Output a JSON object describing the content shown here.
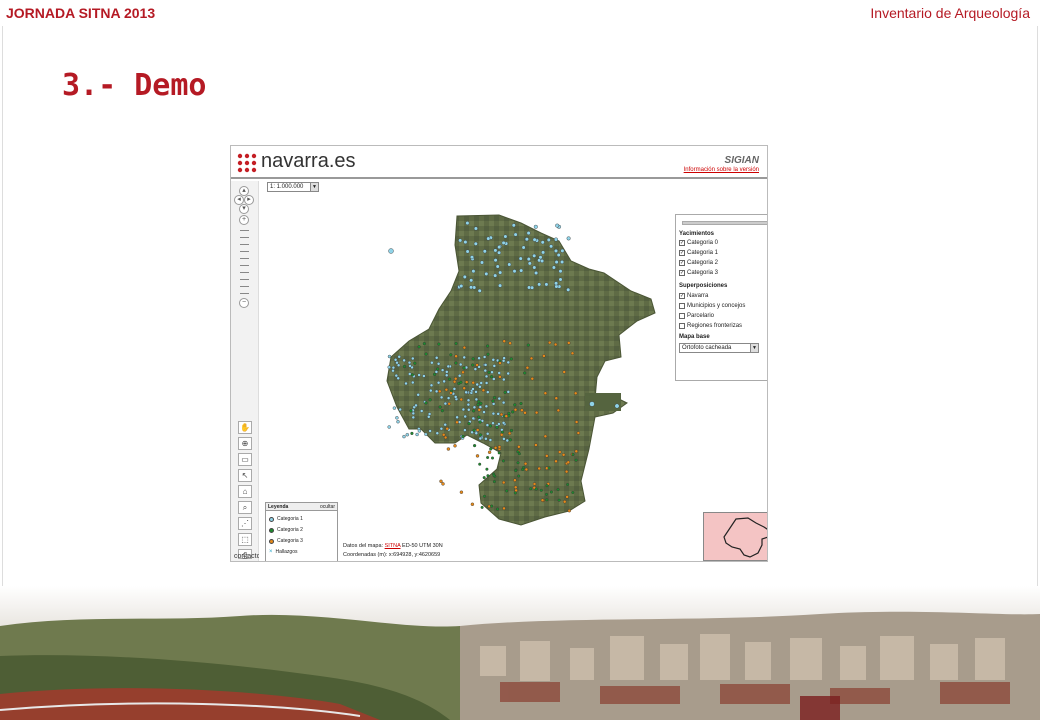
{
  "slide": {
    "header_left": "JORNADA SITNA 2013",
    "header_right": "Inventario de Arqueología",
    "title": "3.- Demo"
  },
  "app": {
    "logo_text": "navarra.es",
    "app_name": "SIGIAN",
    "version_link": "Información sobre la versión",
    "scale_value": "1: 1.000.000",
    "contact_label": "contacto",
    "layer_panel": {
      "close_glyph": "x",
      "yacimientos_heading": "Yacimientos",
      "yacimientos": [
        {
          "label": "Categoria 0",
          "checked": true
        },
        {
          "label": "Categoria 1",
          "checked": true
        },
        {
          "label": "Categoria 2",
          "checked": true
        },
        {
          "label": "Categoria 3",
          "checked": true
        }
      ],
      "superposiciones_heading": "Superposiciones",
      "superposiciones": [
        {
          "label": "Navarra",
          "checked": true
        },
        {
          "label": "Municipios y concejos",
          "checked": false
        },
        {
          "label": "Parcelario",
          "checked": false
        },
        {
          "label": "Regiones fronterizas",
          "checked": false
        }
      ],
      "mapa_base_heading": "Mapa base",
      "mapa_base_value": "Ortofoto cacheada"
    },
    "legend": {
      "title": "Leyenda",
      "hide_label": "ocultar",
      "items": [
        {
          "label": "Categoria 1",
          "color": "#8fd3e8"
        },
        {
          "label": "Categoria 2",
          "color": "#1e8a2e"
        },
        {
          "label": "Categoria 3",
          "color": "#e68a1a"
        },
        {
          "label": "Hallazgos",
          "color": "#2aa8c8"
        }
      ]
    },
    "map_info": {
      "datos_prefix": "Datos del mapa:",
      "datos_link": "SITNA",
      "datos_suffix": "ED-50 UTM 30N",
      "coords": "Coordenadas (m): x:694928, y:4620659"
    }
  },
  "colors": {
    "accent": "#b51a24"
  }
}
